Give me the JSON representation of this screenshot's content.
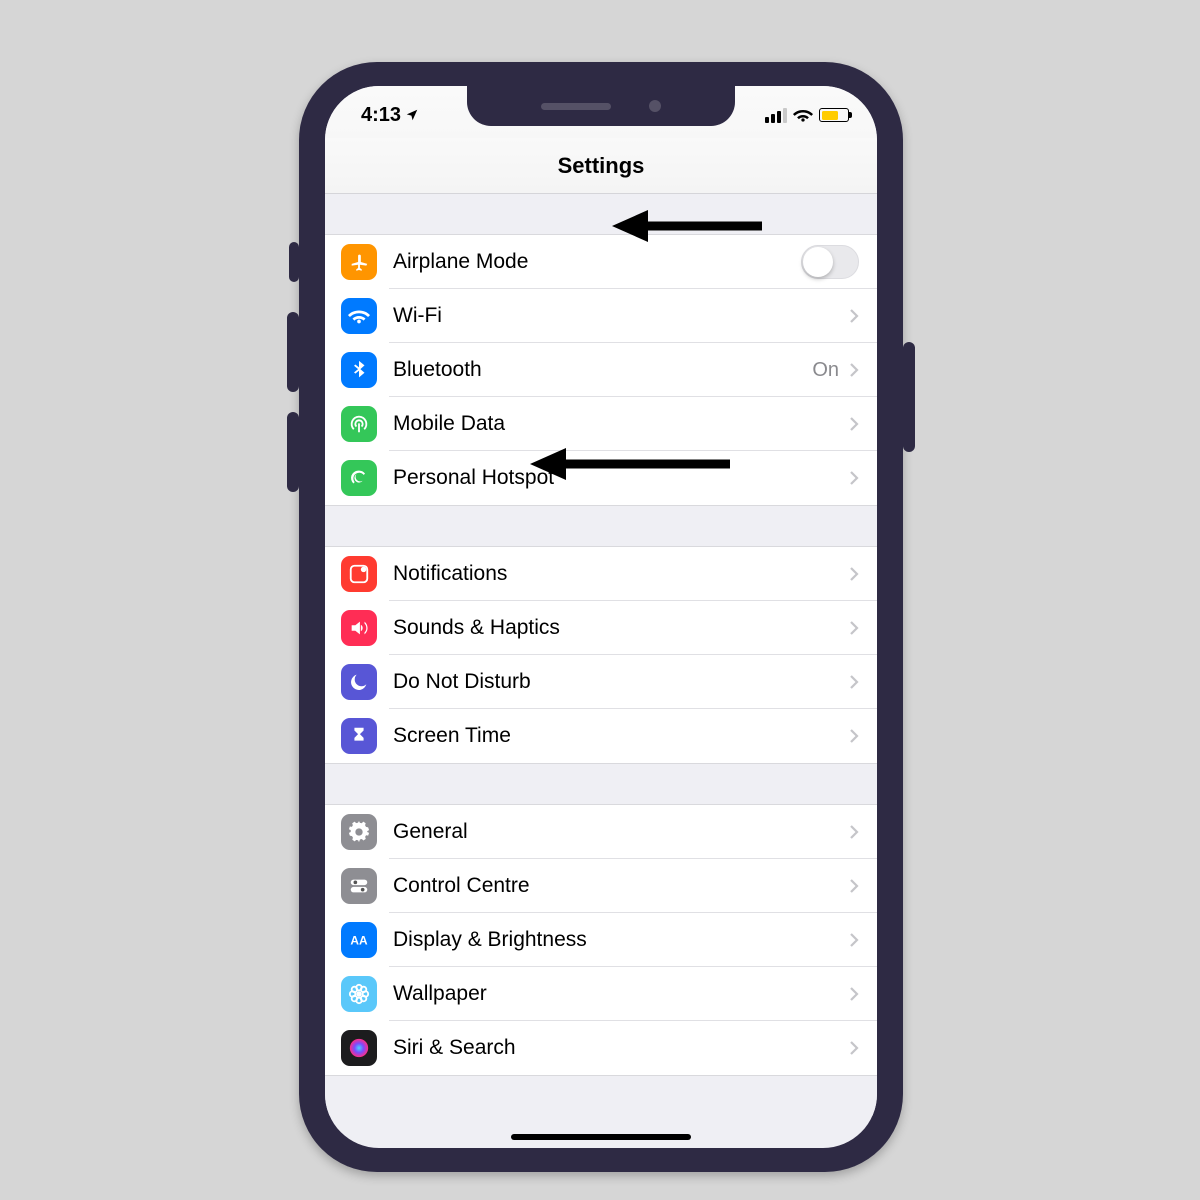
{
  "status": {
    "time": "4:13"
  },
  "header": {
    "title": "Settings"
  },
  "groups": [
    {
      "rows": [
        {
          "icon": "airplane",
          "color": "c-orange",
          "label": "Airplane Mode",
          "accessory": "switch"
        },
        {
          "icon": "wifi",
          "color": "c-blue",
          "label": "Wi-Fi",
          "accessory": "chevron"
        },
        {
          "icon": "bluetooth",
          "color": "c-blue",
          "label": "Bluetooth",
          "detail": "On",
          "accessory": "chevron"
        },
        {
          "icon": "antenna",
          "color": "c-green",
          "label": "Mobile Data",
          "accessory": "chevron"
        },
        {
          "icon": "hotspot",
          "color": "c-green",
          "label": "Personal Hotspot",
          "accessory": "chevron"
        }
      ]
    },
    {
      "rows": [
        {
          "icon": "notifications",
          "color": "c-red",
          "label": "Notifications",
          "accessory": "chevron"
        },
        {
          "icon": "sounds",
          "color": "c-pink",
          "label": "Sounds & Haptics",
          "accessory": "chevron"
        },
        {
          "icon": "dnd",
          "color": "c-purple",
          "label": "Do Not Disturb",
          "accessory": "chevron"
        },
        {
          "icon": "hourglass",
          "color": "c-hourglass",
          "label": "Screen Time",
          "accessory": "chevron"
        }
      ]
    },
    {
      "rows": [
        {
          "icon": "gear",
          "color": "c-grey",
          "label": "General",
          "accessory": "chevron"
        },
        {
          "icon": "switches",
          "color": "c-grey",
          "label": "Control Centre",
          "accessory": "chevron"
        },
        {
          "icon": "aa",
          "color": "c-blue",
          "label": "Display & Brightness",
          "accessory": "chevron"
        },
        {
          "icon": "flower",
          "color": "c-teal",
          "label": "Wallpaper",
          "accessory": "chevron"
        },
        {
          "icon": "siri",
          "color": "c-black",
          "label": "Siri & Search",
          "accessory": "chevron"
        }
      ]
    }
  ]
}
